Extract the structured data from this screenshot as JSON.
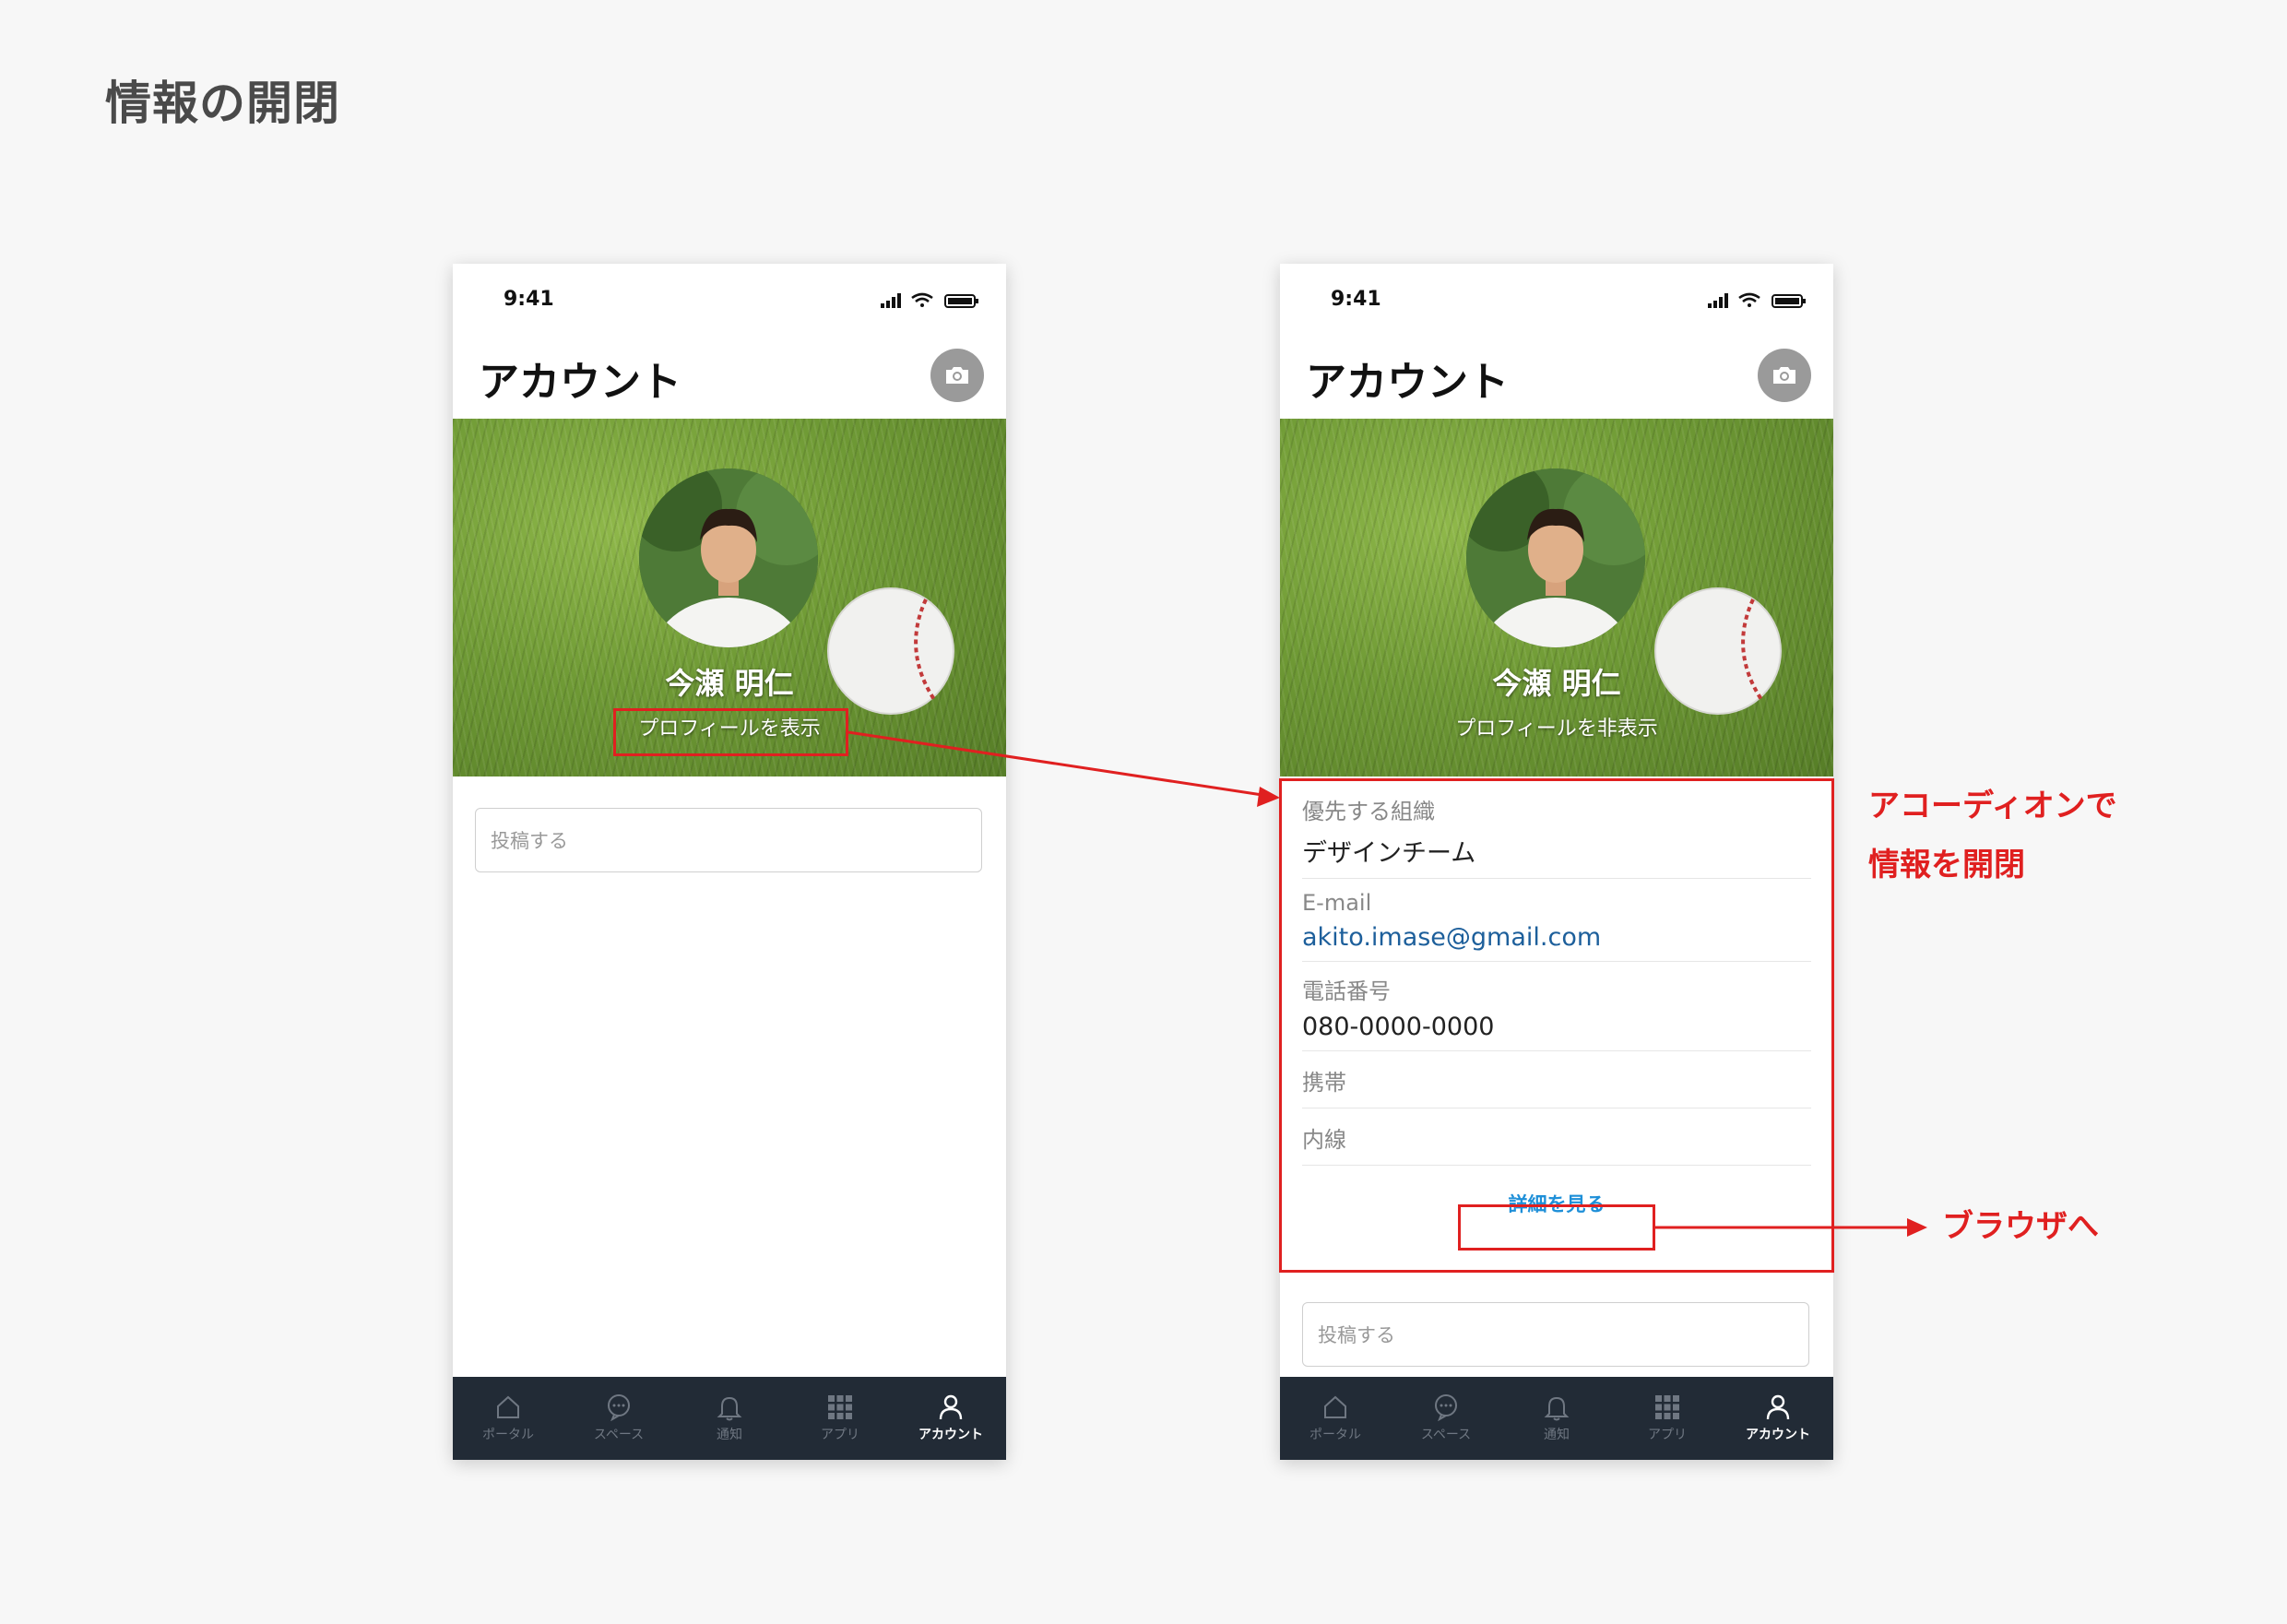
{
  "page_title": "情報の開閉",
  "status_bar": {
    "time": "9:41"
  },
  "screen": {
    "title": "アカウント",
    "user_name": "今瀬 明仁"
  },
  "left_phone": {
    "profile_toggle": "プロフィールを表示",
    "post_placeholder": "投稿する"
  },
  "right_phone": {
    "profile_toggle": "プロフィールを非表示",
    "fields": [
      {
        "label": "優先する組織",
        "value": "デザインチーム"
      },
      {
        "label": "E-mail",
        "value": "akito.imase@gmail.com"
      },
      {
        "label": "電話番号",
        "value": "080-0000-0000"
      },
      {
        "label": "携帯",
        "value": ""
      },
      {
        "label": "内線",
        "value": ""
      }
    ],
    "detail_link": "詳細を見る",
    "post_placeholder": "投稿する"
  },
  "tabs": [
    {
      "label": "ポータル",
      "icon": "home-icon"
    },
    {
      "label": "スペース",
      "icon": "chat-icon"
    },
    {
      "label": "通知",
      "icon": "bell-icon"
    },
    {
      "label": "アプリ",
      "icon": "grid-icon"
    },
    {
      "label": "アカウント",
      "icon": "person-icon",
      "active": true
    }
  ],
  "annotations": {
    "accordion_line1": "アコーディオンで",
    "accordion_line2": "情報を開閉",
    "browser": "ブラウザへ"
  },
  "colors": {
    "annotation_red": "#e02020",
    "tabbar": "#222b36",
    "link_blue": "#1e8fd8",
    "email_blue": "#1d5f9b"
  }
}
